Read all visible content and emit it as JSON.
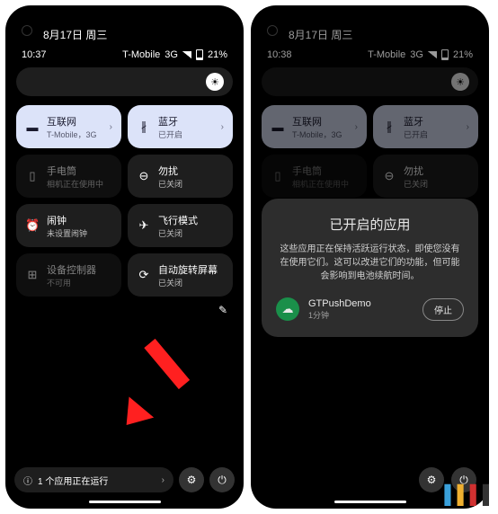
{
  "left": {
    "date": "8月17日 周三",
    "time": "10:37",
    "carrier": "T-Mobile",
    "network": "3G",
    "battery": "21%",
    "tiles": [
      {
        "title": "互联网",
        "sub": "T-Mobile，3G",
        "on": true,
        "icon": "wifi"
      },
      {
        "title": "蓝牙",
        "sub": "已开启",
        "on": true,
        "icon": "bt"
      },
      {
        "title": "手电筒",
        "sub": "相机正在使用中",
        "on": false,
        "disabled": true,
        "icon": "flash"
      },
      {
        "title": "勿扰",
        "sub": "已关闭",
        "on": false,
        "icon": "dnd"
      },
      {
        "title": "闹钟",
        "sub": "未设置闹钟",
        "on": false,
        "icon": "alarm"
      },
      {
        "title": "飞行模式",
        "sub": "已关闭",
        "on": false,
        "icon": "plane"
      },
      {
        "title": "设备控制器",
        "sub": "不可用",
        "on": false,
        "disabled": true,
        "icon": "devices"
      },
      {
        "title": "自动旋转屏幕",
        "sub": "已关闭",
        "on": false,
        "icon": "rotate"
      }
    ],
    "running": "1 个应用正在运行"
  },
  "right": {
    "date": "8月17日 周三",
    "time": "10:38",
    "carrier": "T-Mobile",
    "network": "3G",
    "battery": "21%",
    "tiles": [
      {
        "title": "互联网",
        "sub": "T-Mobile，3G",
        "on": true,
        "icon": "wifi"
      },
      {
        "title": "蓝牙",
        "sub": "已开启",
        "on": true,
        "icon": "bt"
      },
      {
        "title": "手电筒",
        "sub": "相机正在使用中",
        "on": false,
        "disabled": true,
        "icon": "flash"
      },
      {
        "title": "勿扰",
        "sub": "已关闭",
        "on": false,
        "icon": "dnd"
      }
    ],
    "dialog": {
      "title": "已开启的应用",
      "body": "这些应用正在保持活跃运行状态，即使您没有在使用它们。这可以改进它们的功能，但可能会影响到电池续航时间。",
      "app_name": "GTPushDemo",
      "app_time": "1分钟",
      "stop": "停止"
    }
  }
}
